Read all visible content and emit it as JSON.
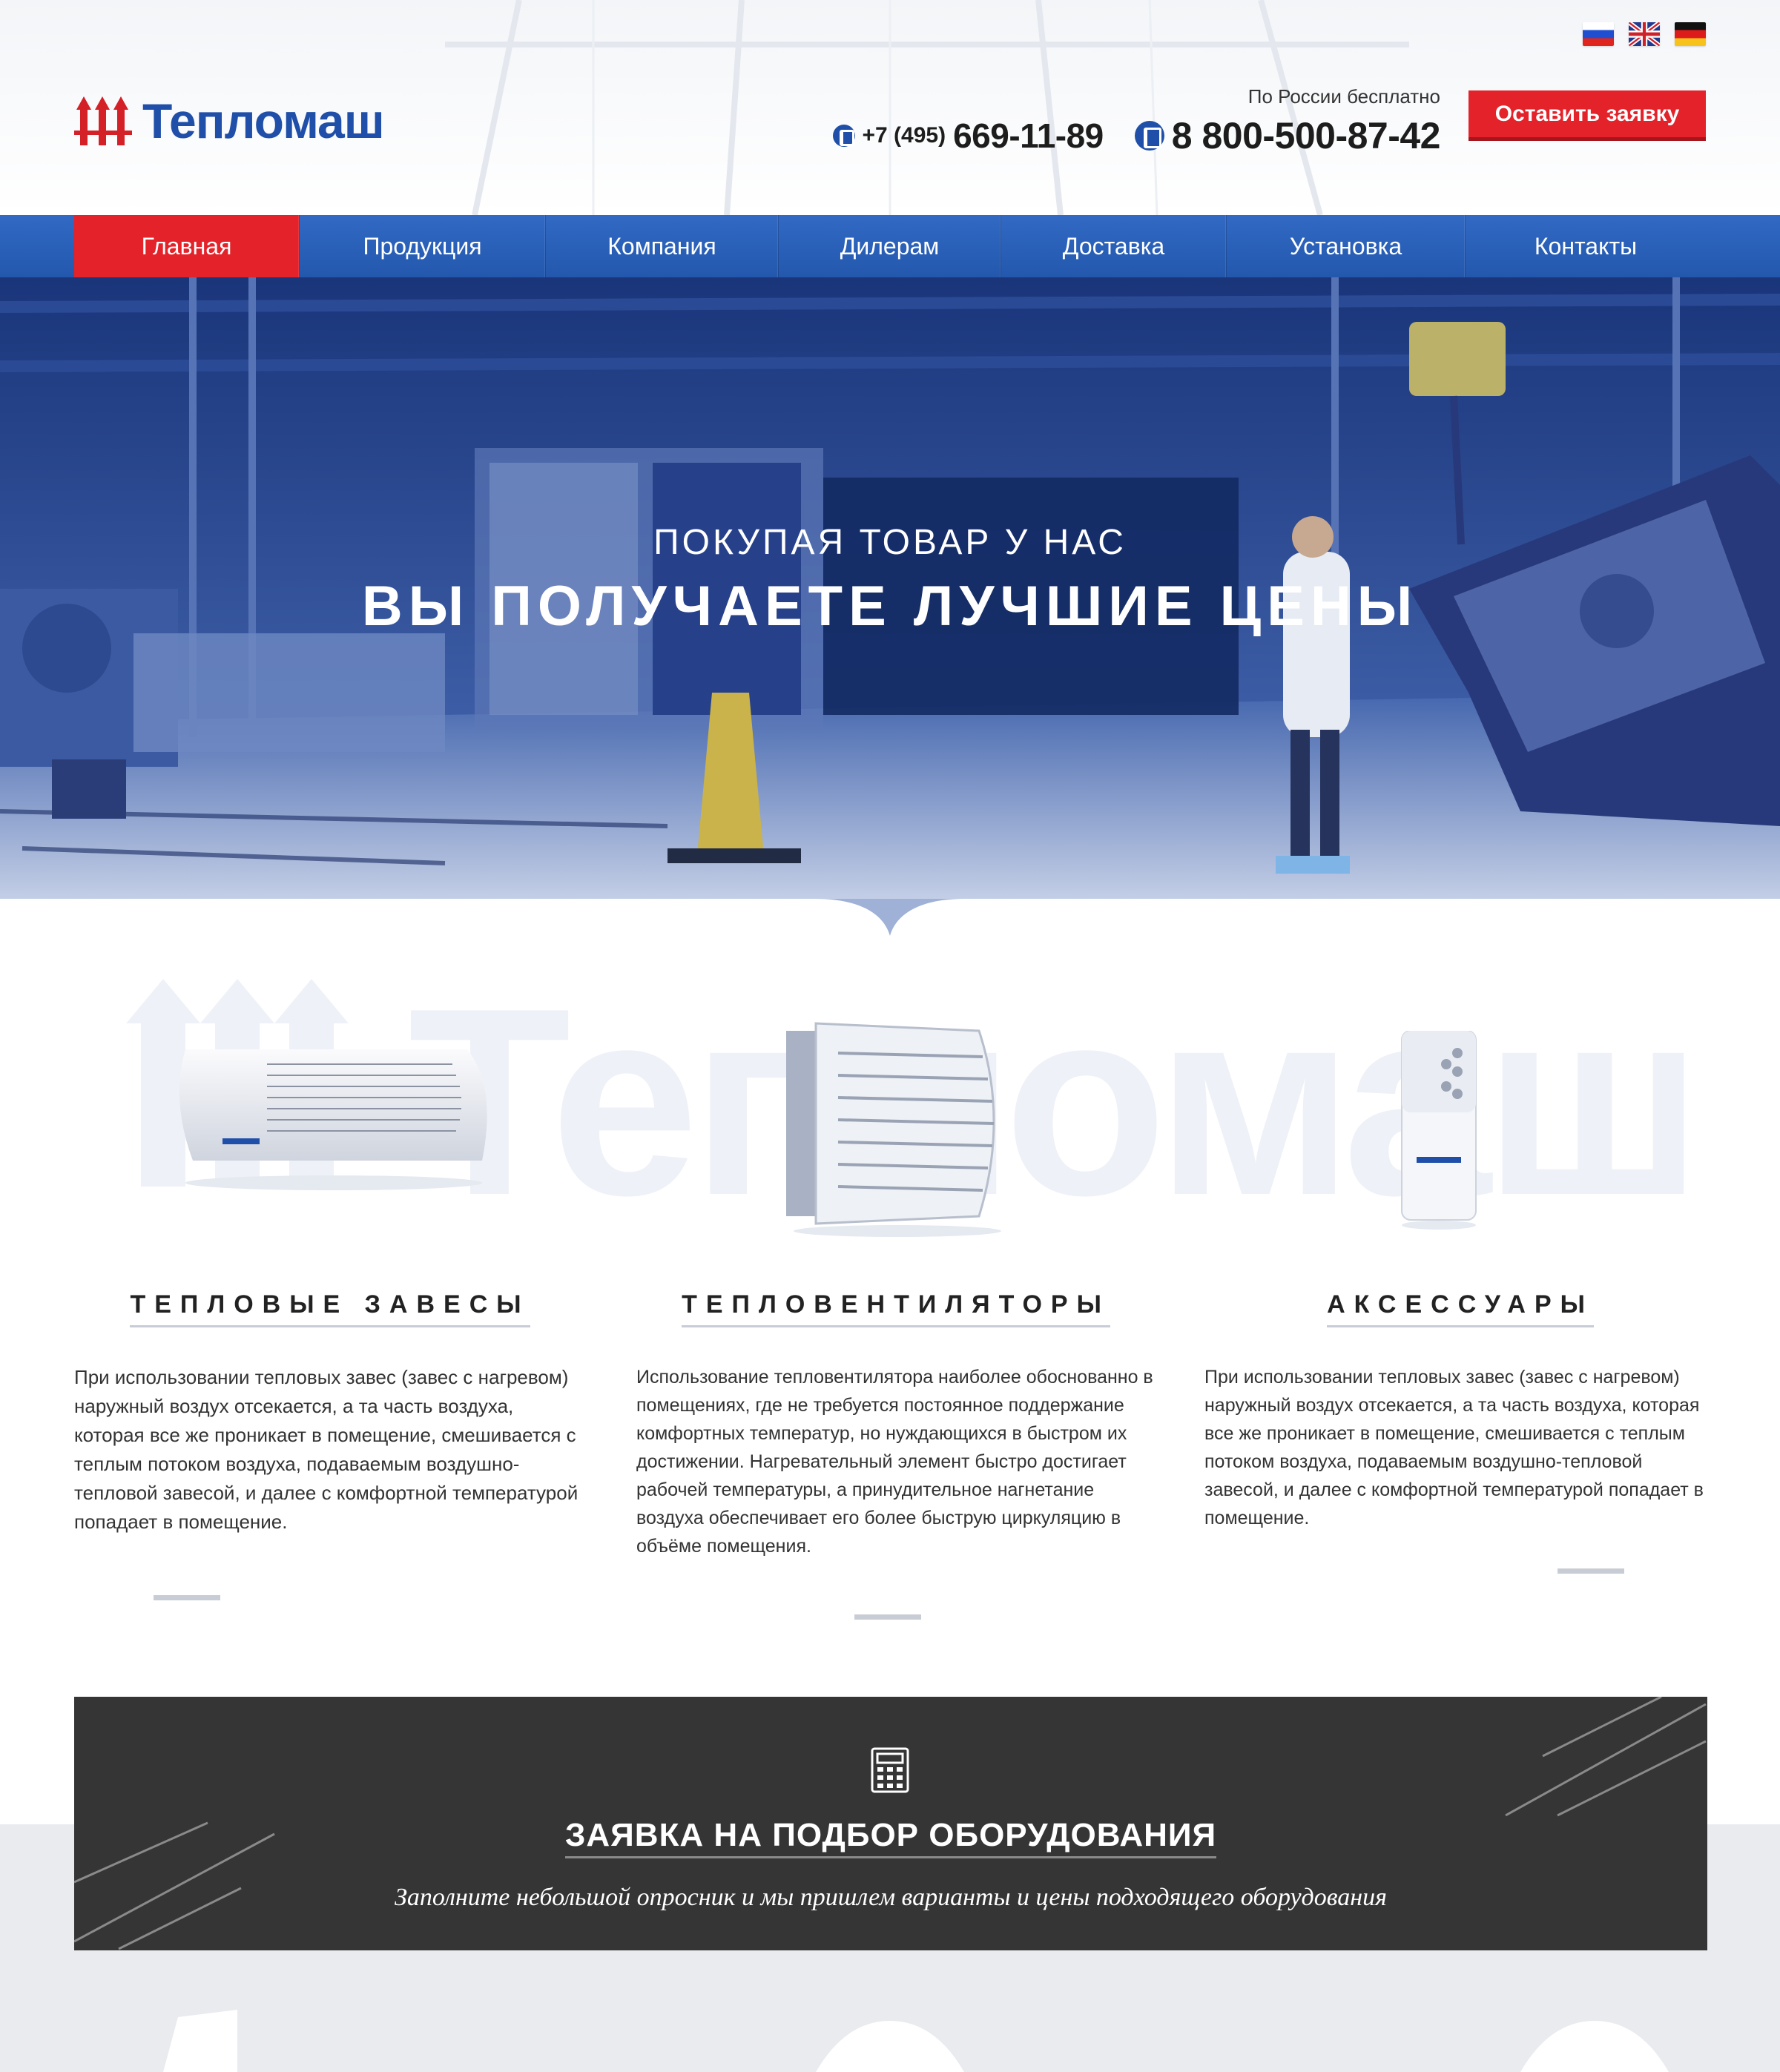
{
  "header": {
    "brand": "Тепломаш",
    "languages": [
      {
        "code": "ru",
        "icon": "flag-ru-icon"
      },
      {
        "code": "en",
        "icon": "flag-uk-icon"
      },
      {
        "code": "de",
        "icon": "flag-de-icon"
      }
    ],
    "phone_note": "По России бесплатно",
    "phone1_code": "+7 (495)",
    "phone1_number": "669-11-89",
    "phone2_number": "8 800-500-87-42",
    "cta_label": "Оставить заявку"
  },
  "nav": {
    "items": [
      {
        "label": "Главная",
        "active": true
      },
      {
        "label": "Продукция"
      },
      {
        "label": "Компания"
      },
      {
        "label": "Дилерам"
      },
      {
        "label": "Доставка"
      },
      {
        "label": "Установка"
      },
      {
        "label": "Контакты"
      }
    ]
  },
  "hero": {
    "subtitle": "ПОКУПАЯ ТОВАР У НАС",
    "title": "ВЫ ПОЛУЧАЕТЕ ЛУЧШИЕ ЦЕНЫ"
  },
  "products": [
    {
      "title": "ТЕПЛОВЫЕ ЗАВЕСЫ",
      "description": "При использовании тепловых завес (завес с нагревом) наружный воздух отсекается, а та часть воздуха, которая все же проникает в помещение, смешивается с теплым потоком воздуха, подаваемым воздушно-тепловой завесой, и далее с комфортной температурой попадает в помещение."
    },
    {
      "title": "ТЕПЛОВЕНТИЛЯТОРЫ",
      "description": "Использование тепловентилятора наиболее обоснованно в помещениях, где не требуется постоянное поддержание комфортных температур, но нуждающихся в быстром их достижении. Нагревательный элемент быстро достигает рабочей температуры, а принудительное нагнетание воздуха обеспечивает его более быструю циркуляцию в объёме помещения."
    },
    {
      "title": "АКСЕССУАРЫ",
      "description": "При использовании тепловых завес (завес с нагревом) наружный воздух отсекается, а та часть воздуха, которая все же проникает в помещение, смешивается с теплым потоком воздуха, подаваемым воздушно-тепловой завесой, и далее с комфортной температурой попадает в помещение."
    }
  ],
  "request_banner": {
    "icon": "calculator-icon",
    "title": "ЗАЯВКА НА ПОДБОР ОБОРУДОВАНИЯ",
    "subtitle": "Заполните небольшой опросник и мы пришлем варианты и цены подходящего оборудования"
  },
  "colors": {
    "brand_blue": "#1f4fa8",
    "nav_blue": "#2b62b8",
    "accent_red": "#e3222a",
    "banner_dark": "#353535"
  }
}
